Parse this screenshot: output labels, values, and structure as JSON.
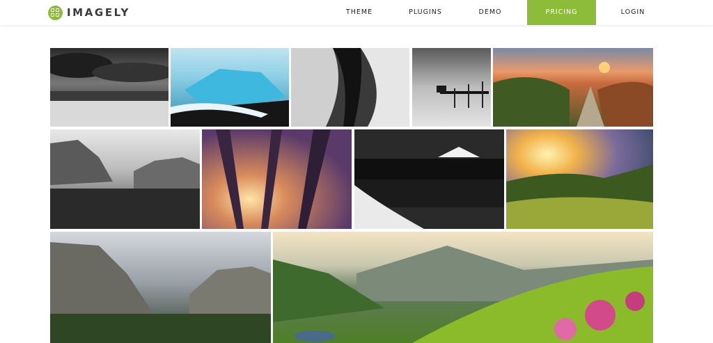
{
  "brand": {
    "name": "IMAGELY",
    "color": "#8dbb3a",
    "icon": "imagely-logo-icon"
  },
  "nav": {
    "items": [
      {
        "label": "THEME",
        "active": false
      },
      {
        "label": "PLUGINS",
        "active": false
      },
      {
        "label": "DEMO",
        "active": false
      },
      {
        "label": "PRICING",
        "active": true
      },
      {
        "label": "LOGIN",
        "active": false
      }
    ]
  },
  "gallery": {
    "photos": [
      "stormy-field-bw",
      "glacier-ice-beach",
      "slot-canyon-bw",
      "pier-long-exposure-bw",
      "rock-pinnacles-sunset",
      "yosemite-valley-bw",
      "redwood-forest-sun",
      "mountain-lake-reflection-bw",
      "sunburst-hills",
      "yosemite-valley-color",
      "flower-meadow-mountains"
    ]
  }
}
